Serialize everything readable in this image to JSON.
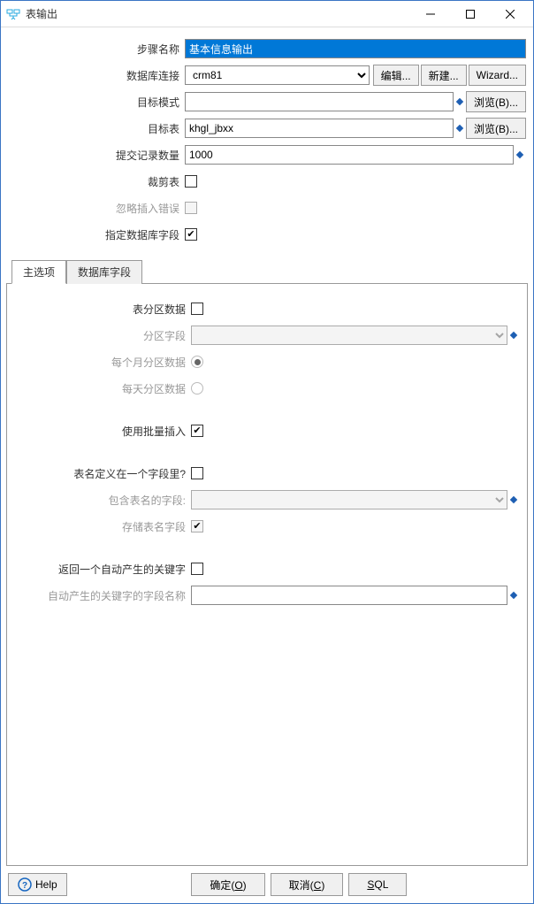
{
  "window": {
    "title": "表输出"
  },
  "form": {
    "step_name_label": "步骤名称",
    "step_name_value": "基本信息输出",
    "db_conn_label": "数据库连接",
    "db_conn_value": "crm81",
    "edit_btn": "编辑...",
    "new_btn": "新建...",
    "wizard_btn": "Wizard...",
    "target_schema_label": "目标模式",
    "target_schema_value": "",
    "browse_btn": "浏览(B)...",
    "target_table_label": "目标表",
    "target_table_value": "khgl_jbxx",
    "commit_size_label": "提交记录数量",
    "commit_size_value": "1000",
    "truncate_label": "裁剪表",
    "ignore_insert_err_label": "忽略插入错误",
    "specify_db_fields_label": "指定数据库字段"
  },
  "tabs": {
    "main_label": "主选项",
    "db_fields_label": "数据库字段"
  },
  "main_tab": {
    "partition_label": "表分区数据",
    "partition_field_label": "分区字段",
    "monthly_partition_label": "每个月分区数据",
    "daily_partition_label": "每天分区数据",
    "use_batch_label": "使用批量插入",
    "table_in_field_label": "表名定义在一个字段里?",
    "contain_table_field_label": "包含表名的字段:",
    "store_table_field_label": "存储表名字段",
    "return_auto_key_label": "返回一个自动产生的关键字",
    "auto_key_field_label": "自动产生的关键字的字段名称"
  },
  "footer": {
    "help_label": "Help",
    "ok_label": "确定(O)",
    "cancel_label": "取消(C)",
    "sql_label": "SQL"
  }
}
